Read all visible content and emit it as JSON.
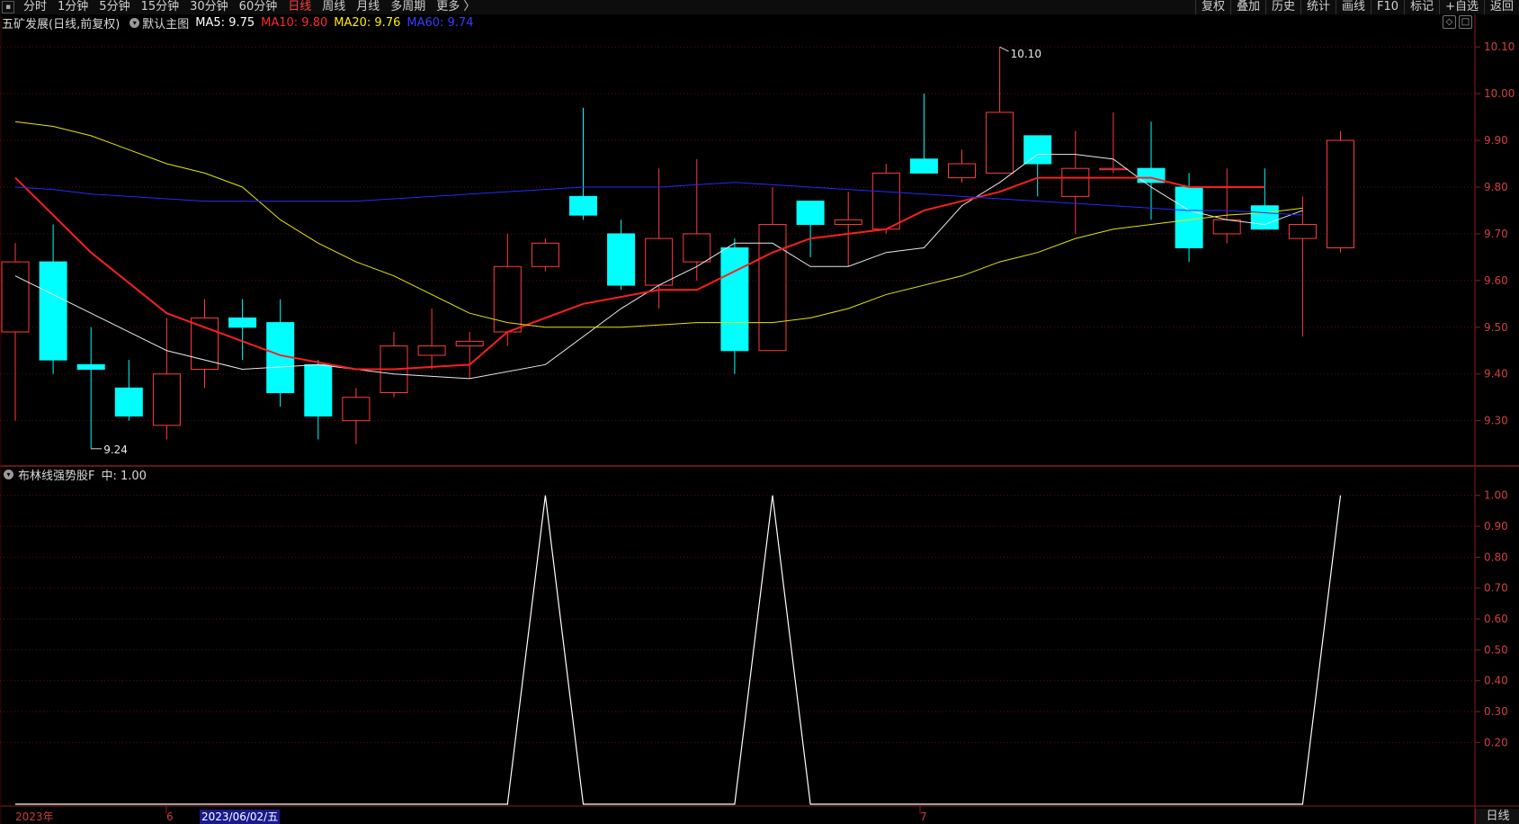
{
  "toolbar": {
    "periods": [
      "分时",
      "1分钟",
      "5分钟",
      "15分钟",
      "30分钟",
      "60分钟",
      "日线",
      "周线",
      "月线",
      "多周期",
      "更多 〉"
    ],
    "active_period": "日线",
    "actions": [
      "复权",
      "叠加",
      "历史",
      "统计",
      "画线",
      "F10",
      "标记",
      "+自选",
      "返回"
    ]
  },
  "main_chart": {
    "title": "五矿发展(日线,前复权)",
    "template": "默认主图",
    "ma_labels": [
      {
        "text": "MA5: 9.75",
        "color": "#ffffff"
      },
      {
        "text": "MA10: 9.80",
        "color": "#ff2a2a"
      },
      {
        "text": "MA20: 9.76",
        "color": "#ffee00"
      },
      {
        "text": "MA60: 9.74",
        "color": "#3c3cff"
      }
    ],
    "high_label": "10.10",
    "low_label": "9.24",
    "y_ticks": [
      "10.10",
      "10.00",
      "9.90",
      "9.80",
      "9.70",
      "9.60",
      "9.50",
      "9.40",
      "9.30"
    ]
  },
  "indicator": {
    "title": "布林线强势股F",
    "value_label": "中: 1.00",
    "y_ticks": [
      "1.00",
      "0.90",
      "0.80",
      "0.70",
      "0.60",
      "0.50",
      "0.40",
      "0.30",
      "0.20"
    ]
  },
  "x_axis": {
    "labels": [
      "2023年",
      "6",
      "2023/06/02/五",
      "7"
    ],
    "period_tab": "日线"
  },
  "chart_data": {
    "type": "candlestick",
    "candles": [
      {
        "o": 9.49,
        "h": 9.68,
        "l": 9.3,
        "c": 9.64
      },
      {
        "o": 9.64,
        "h": 9.72,
        "l": 9.4,
        "c": 9.43
      },
      {
        "o": 9.42,
        "h": 9.5,
        "l": 9.24,
        "c": 9.41
      },
      {
        "o": 9.37,
        "h": 9.43,
        "l": 9.3,
        "c": 9.31
      },
      {
        "o": 9.29,
        "h": 9.52,
        "l": 9.26,
        "c": 9.4
      },
      {
        "o": 9.41,
        "h": 9.56,
        "l": 9.37,
        "c": 9.52
      },
      {
        "o": 9.52,
        "h": 9.56,
        "l": 9.43,
        "c": 9.5
      },
      {
        "o": 9.51,
        "h": 9.56,
        "l": 9.33,
        "c": 9.36
      },
      {
        "o": 9.42,
        "h": 9.43,
        "l": 9.26,
        "c": 9.31
      },
      {
        "o": 9.3,
        "h": 9.37,
        "l": 9.25,
        "c": 9.35
      },
      {
        "o": 9.36,
        "h": 9.49,
        "l": 9.35,
        "c": 9.46
      },
      {
        "o": 9.44,
        "h": 9.54,
        "l": 9.41,
        "c": 9.46
      },
      {
        "o": 9.46,
        "h": 9.49,
        "l": 9.39,
        "c": 9.47
      },
      {
        "o": 9.49,
        "h": 9.7,
        "l": 9.46,
        "c": 9.63
      },
      {
        "o": 9.63,
        "h": 9.69,
        "l": 9.62,
        "c": 9.68
      },
      {
        "o": 9.78,
        "h": 9.97,
        "l": 9.73,
        "c": 9.74
      },
      {
        "o": 9.7,
        "h": 9.73,
        "l": 9.58,
        "c": 9.59
      },
      {
        "o": 9.59,
        "h": 9.84,
        "l": 9.54,
        "c": 9.69
      },
      {
        "o": 9.64,
        "h": 9.86,
        "l": 9.6,
        "c": 9.7
      },
      {
        "o": 9.67,
        "h": 9.69,
        "l": 9.4,
        "c": 9.45
      },
      {
        "o": 9.45,
        "h": 9.8,
        "l": 9.45,
        "c": 9.72
      },
      {
        "o": 9.77,
        "h": 9.77,
        "l": 9.65,
        "c": 9.72
      },
      {
        "o": 9.72,
        "h": 9.79,
        "l": 9.63,
        "c": 9.73
      },
      {
        "o": 9.71,
        "h": 9.85,
        "l": 9.7,
        "c": 9.83
      },
      {
        "o": 9.86,
        "h": 10.0,
        "l": 9.83,
        "c": 9.83
      },
      {
        "o": 9.82,
        "h": 9.88,
        "l": 9.81,
        "c": 9.85
      },
      {
        "o": 9.83,
        "h": 10.1,
        "l": 9.83,
        "c": 9.96
      },
      {
        "o": 9.91,
        "h": 9.91,
        "l": 9.78,
        "c": 9.85
      },
      {
        "o": 9.78,
        "h": 9.92,
        "l": 9.7,
        "c": 9.84
      },
      {
        "o": 9.84,
        "h": 9.96,
        "l": 9.83,
        "c": 9.84
      },
      {
        "o": 9.84,
        "h": 9.94,
        "l": 9.73,
        "c": 9.81
      },
      {
        "o": 9.8,
        "h": 9.83,
        "l": 9.64,
        "c": 9.67
      },
      {
        "o": 9.7,
        "h": 9.84,
        "l": 9.68,
        "c": 9.73
      },
      {
        "o": 9.76,
        "h": 9.84,
        "l": 9.71,
        "c": 9.71
      },
      {
        "o": 9.69,
        "h": 9.78,
        "l": 9.48,
        "c": 9.72
      },
      {
        "o": 9.67,
        "h": 9.92,
        "l": 9.66,
        "c": 9.9
      }
    ],
    "ma": {
      "MA5": [
        9.61,
        null,
        9.53,
        null,
        9.45,
        null,
        9.41,
        null,
        9.42,
        null,
        9.4,
        null,
        9.39,
        null,
        9.42,
        null,
        9.54,
        9.59,
        9.63,
        9.68,
        9.68,
        9.63,
        9.63,
        9.66,
        9.67,
        9.76,
        9.81,
        9.87,
        9.87,
        9.86,
        9.8,
        9.75,
        9.73,
        9.72,
        9.75
      ],
      "MA10": [
        9.82,
        null,
        9.66,
        null,
        9.53,
        9.5,
        null,
        9.44,
        null,
        9.41,
        9.41,
        null,
        9.42,
        9.49,
        9.52,
        9.55,
        null,
        9.58,
        9.58,
        9.62,
        9.66,
        9.69,
        9.7,
        9.71,
        9.75,
        9.77,
        9.79,
        9.82,
        9.82,
        9.82,
        9.82,
        9.8,
        9.8,
        9.8
      ],
      "MA20": [
        9.94,
        9.93,
        9.91,
        9.88,
        9.85,
        9.83,
        9.8,
        9.73,
        9.68,
        9.64,
        9.61,
        9.57,
        9.53,
        9.51,
        9.5,
        9.5,
        9.5,
        9.505,
        9.51,
        9.51,
        9.51,
        9.52,
        9.54,
        9.57,
        9.59,
        9.61,
        9.64,
        9.66,
        9.69,
        9.71,
        9.72,
        9.73,
        9.74,
        9.745,
        9.755
      ],
      "MA60": [
        9.8,
        9.795,
        9.785,
        9.78,
        9.775,
        9.77,
        9.77,
        9.77,
        9.77,
        9.77,
        9.775,
        9.78,
        9.785,
        9.79,
        9.795,
        9.8,
        9.8,
        9.8,
        9.805,
        9.81,
        9.805,
        9.8,
        9.795,
        9.79,
        9.785,
        9.78,
        9.775,
        9.77,
        9.765,
        9.76,
        9.755,
        9.75,
        9.75,
        9.745,
        9.74
      ]
    },
    "indicator_values": [
      0,
      0,
      0,
      0,
      0,
      0,
      0,
      0,
      0,
      0,
      0,
      0,
      0,
      0,
      1,
      0,
      0,
      0,
      0,
      0,
      1,
      0,
      0,
      0,
      0,
      0,
      0,
      0,
      0,
      0,
      0,
      0,
      0,
      0,
      0,
      1
    ],
    "price_range": [
      9.205,
      10.135
    ],
    "indicator_range": [
      0.0,
      1.04
    ]
  }
}
